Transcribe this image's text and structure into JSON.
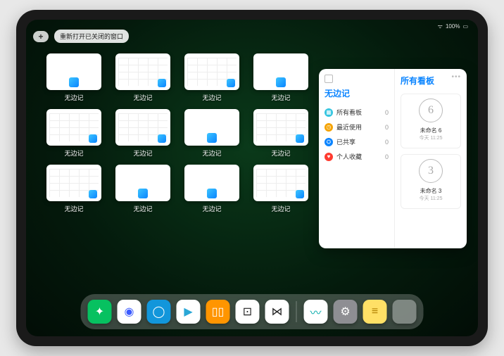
{
  "status": {
    "wifi": "wifi-icon",
    "battery": "100%"
  },
  "topbar": {
    "plus": "+",
    "reopen_label": "重新打开已关闭的窗口"
  },
  "window_label": "无边记",
  "windows": [
    {
      "thumb": "blank"
    },
    {
      "thumb": "grid"
    },
    {
      "thumb": "grid"
    },
    {
      "thumb": "blank"
    },
    {
      "thumb": "grid"
    },
    {
      "thumb": "grid"
    },
    {
      "thumb": "blank"
    },
    {
      "thumb": "grid"
    },
    {
      "thumb": "grid"
    },
    {
      "thumb": "blank"
    },
    {
      "thumb": "blank"
    },
    {
      "thumb": "grid"
    }
  ],
  "panel": {
    "left_title": "无边记",
    "rows": [
      {
        "icon": "grid",
        "color": "#34c5e0",
        "label": "所有看板",
        "count": 0
      },
      {
        "icon": "clock",
        "color": "#f5a300",
        "label": "最近使用",
        "count": 0
      },
      {
        "icon": "people",
        "color": "#0a84ff",
        "label": "已共享",
        "count": 0
      },
      {
        "icon": "heart",
        "color": "#ff3b30",
        "label": "个人收藏",
        "count": 0
      }
    ],
    "right_title": "所有看板",
    "boards": [
      {
        "glyph": "6",
        "name": "未命名 6",
        "time": "今天 11:25"
      },
      {
        "glyph": "3",
        "name": "未命名 3",
        "time": "今天 11:25"
      }
    ]
  },
  "dock": [
    {
      "name": "wechat",
      "bg": "#07c160",
      "glyph": "✦"
    },
    {
      "name": "quark",
      "bg": "#ffffff",
      "glyph": "◉",
      "fg": "#3b5bff"
    },
    {
      "name": "qqbrowser",
      "bg": "#1296db",
      "glyph": "◯"
    },
    {
      "name": "play",
      "bg": "#ffffff",
      "glyph": "▶",
      "fg": "#2aa7d6"
    },
    {
      "name": "books",
      "bg": "#ff9500",
      "glyph": "▯▯"
    },
    {
      "name": "dice",
      "bg": "#ffffff",
      "glyph": "⊡",
      "fg": "#222"
    },
    {
      "name": "connect",
      "bg": "#ffffff",
      "glyph": "⋈",
      "fg": "#222"
    },
    {
      "sep": true
    },
    {
      "name": "freeform",
      "bg": "#ffffff",
      "glyph": "〰",
      "fg": "#0aa"
    },
    {
      "name": "settings",
      "bg": "#8e8e93",
      "glyph": "⚙"
    },
    {
      "name": "notes",
      "bg": "#ffe066",
      "glyph": "≡",
      "fg": "#b08000"
    },
    {
      "folder": true
    }
  ]
}
